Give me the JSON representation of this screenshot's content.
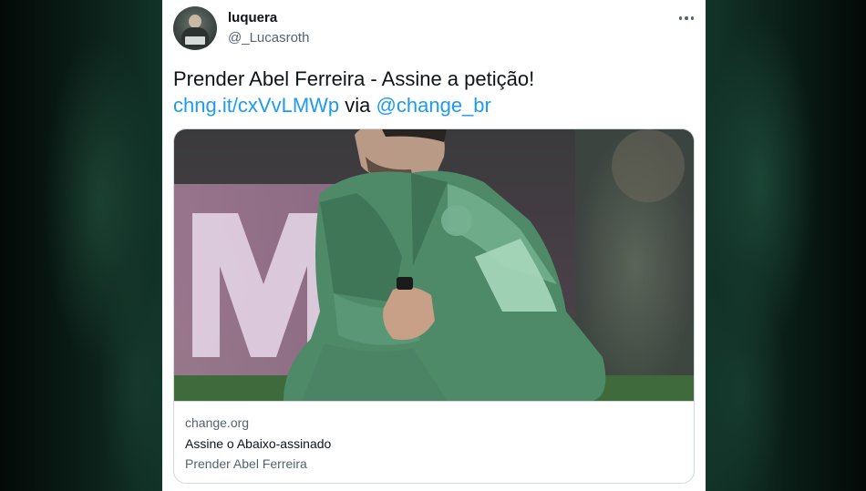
{
  "author": {
    "display_name": "luquera",
    "handle": "@_Lucasroth"
  },
  "tweet": {
    "text_line1": "Prender Abel Ferreira - Assine a petição!",
    "link_short": "chng.it/cxVvLMWp",
    "via_word": "via",
    "mention": "@change_br"
  },
  "card": {
    "domain": "change.org",
    "title": "Assine o Abaixo-assinado",
    "description": "Prender Abel Ferreira"
  },
  "colors": {
    "link": "#1d9bf0",
    "text": "#0f1419",
    "secondary": "#536471",
    "jacket_green": "#4e8a68"
  },
  "icons": {
    "more": "more-horizontal-icon",
    "badge": "club-crest-icon"
  }
}
